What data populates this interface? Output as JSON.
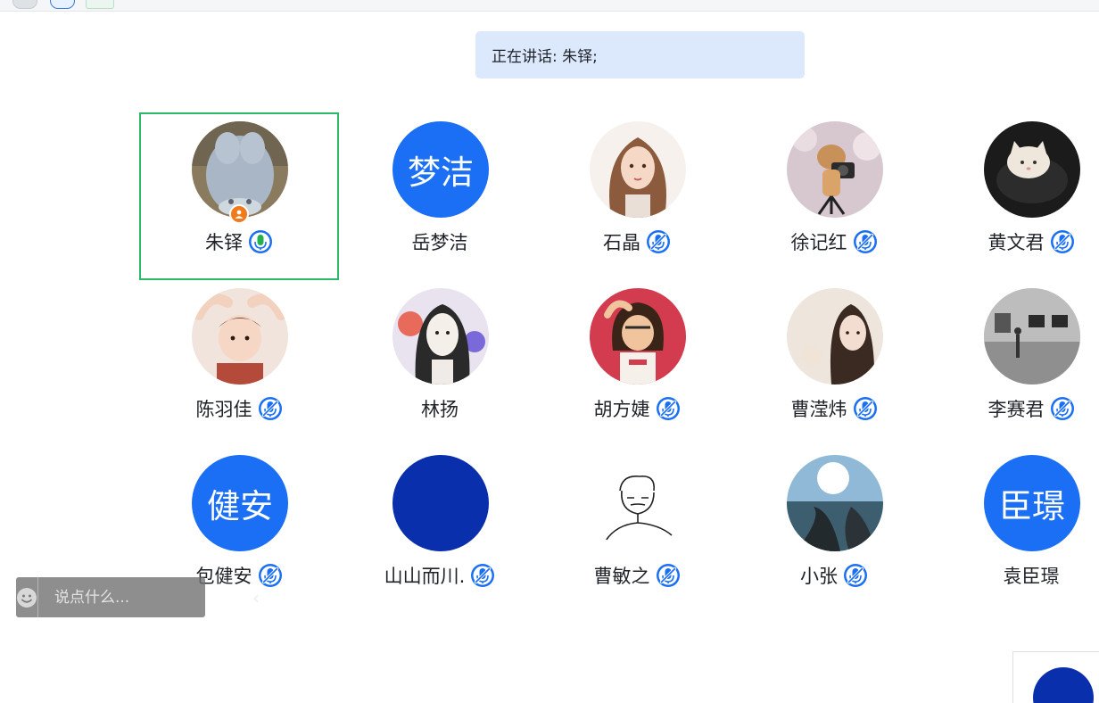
{
  "speaking_banner": {
    "text": "正在讲话: 朱铎;"
  },
  "participants": [
    {
      "name": "朱铎",
      "avatar_type": "photo",
      "avatar_desc": "plush-toy-photo",
      "mic": "on",
      "host": true,
      "active": true
    },
    {
      "name": "岳梦洁",
      "avatar_type": "text",
      "avatar_text": "梦洁",
      "mic": "none"
    },
    {
      "name": "石晶",
      "avatar_type": "photo",
      "avatar_desc": "illustrated-girl",
      "mic": "muted"
    },
    {
      "name": "徐记红",
      "avatar_type": "photo",
      "avatar_desc": "cat-with-camera",
      "mic": "muted"
    },
    {
      "name": "黄文君",
      "avatar_type": "photo",
      "avatar_desc": "white-kitten",
      "mic": "muted"
    },
    {
      "name": "陈羽佳",
      "avatar_type": "photo",
      "avatar_desc": "toddler",
      "mic": "muted"
    },
    {
      "name": "林扬",
      "avatar_type": "photo",
      "avatar_desc": "anime-woman",
      "mic": "none"
    },
    {
      "name": "胡方婕",
      "avatar_type": "photo",
      "avatar_desc": "cartoon-girl",
      "mic": "muted"
    },
    {
      "name": "曹滢炜",
      "avatar_type": "photo",
      "avatar_desc": "girl-with-cat",
      "mic": "muted"
    },
    {
      "name": "李赛君",
      "avatar_type": "photo",
      "avatar_desc": "gallery-room",
      "mic": "muted"
    },
    {
      "name": "包健安",
      "avatar_type": "text",
      "avatar_text": "健安",
      "mic": "muted"
    },
    {
      "name": "山山而川.",
      "avatar_type": "solid",
      "avatar_desc": "solid-blue",
      "mic": "muted"
    },
    {
      "name": "曹敏之",
      "avatar_type": "photo",
      "avatar_desc": "line-sketch",
      "mic": "muted"
    },
    {
      "name": "小张",
      "avatar_type": "photo",
      "avatar_desc": "road-landscape",
      "mic": "muted"
    },
    {
      "name": "袁臣璟",
      "avatar_type": "text",
      "avatar_text": "臣璟",
      "mic": "none"
    }
  ],
  "chat": {
    "placeholder": "说点什么...",
    "emoji_icon": "smile-icon",
    "collapse_glyph": "‹"
  },
  "colors": {
    "brand_blue": "#1a6ff5",
    "active_border": "#2db968",
    "host_badge": "#f27a1a",
    "mic_on": "#22b14c",
    "banner_bg": "#dce9fd"
  }
}
